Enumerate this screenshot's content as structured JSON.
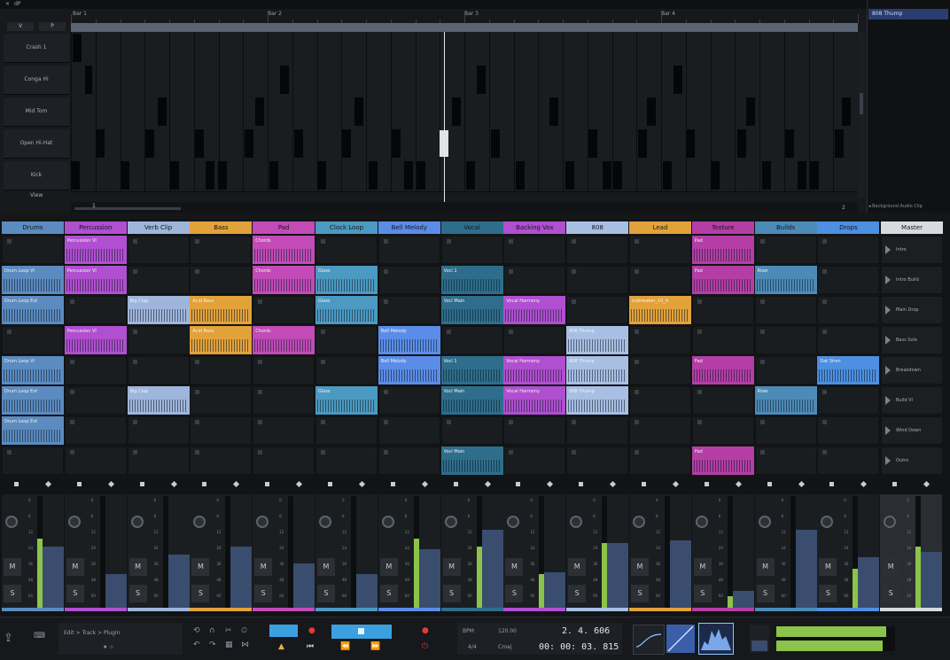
{
  "colors": {
    "drums": "#5b8bc0",
    "percussion": "#b04fd0",
    "verb_clip": "#9fb6dc",
    "bass": "#e2a23a",
    "pad": "#c24bb8",
    "clock_loop": "#4c9ac2",
    "bell_melody": "#5b8de8",
    "vocal": "#2e6e8c",
    "backing_vox": "#b04fd0",
    "p808": "#a8bfe4",
    "lead": "#e2a23a",
    "texture": "#b43ea6",
    "builds": "#4c8bb8",
    "drops": "#4d8fe0",
    "master": "#d7dbe0",
    "accent_blue": "#3aa0e0",
    "meter_green": "#8cc34a",
    "record_red": "#e23a3a"
  },
  "roll": {
    "view_buttons": [
      "V",
      "P"
    ],
    "bars": [
      "Bar 1",
      "Bar 2",
      "Bar 3",
      "Bar 4"
    ],
    "lanes": [
      "Crash 1",
      "Conga Hi",
      "Mid Tom",
      "Open Hi-Hat",
      "Kick"
    ],
    "view_label": "View",
    "position_label": "1",
    "zoom_readout": "2"
  },
  "browser": {
    "selected": "808 Thump",
    "footer": "Background Audio Clip"
  },
  "tracks": [
    {
      "name": "Drums",
      "color": "drums"
    },
    {
      "name": "Percussion",
      "color": "percussion"
    },
    {
      "name": "Verb Clip",
      "color": "verb_clip"
    },
    {
      "name": "Bass",
      "color": "bass"
    },
    {
      "name": "Pad",
      "color": "pad"
    },
    {
      "name": "Clock Loop",
      "color": "clock_loop"
    },
    {
      "name": "Bell Melody",
      "color": "bell_melody"
    },
    {
      "name": "Vocal",
      "color": "vocal"
    },
    {
      "name": "Backing Vox",
      "color": "backing_vox"
    },
    {
      "name": "808",
      "color": "p808"
    },
    {
      "name": "Lead",
      "color": "lead"
    },
    {
      "name": "Texture",
      "color": "texture"
    },
    {
      "name": "Builds",
      "color": "builds"
    },
    {
      "name": "Drops",
      "color": "drops"
    }
  ],
  "master": {
    "name": "Master"
  },
  "scenes": [
    "Intro",
    "Intro Build",
    "Main Drop",
    "Bass Solo",
    "Breakdown",
    "Build Vl",
    "Wind Down",
    "Outro"
  ],
  "clips": [
    {
      "t": 1,
      "s": 0,
      "label": "Percussion Vl"
    },
    {
      "t": 4,
      "s": 0,
      "label": "Chords"
    },
    {
      "t": 11,
      "s": 0,
      "label": "Pad"
    },
    {
      "t": 0,
      "s": 1,
      "label": "Drum Loop Vl"
    },
    {
      "t": 1,
      "s": 1,
      "label": "Percussion Vl"
    },
    {
      "t": 4,
      "s": 1,
      "label": "Chords"
    },
    {
      "t": 5,
      "s": 1,
      "label": "Glass"
    },
    {
      "t": 7,
      "s": 1,
      "label": "Vocl 1"
    },
    {
      "t": 11,
      "s": 1,
      "label": "Pad"
    },
    {
      "t": 12,
      "s": 1,
      "label": "Riser"
    },
    {
      "t": 0,
      "s": 2,
      "label": "Drum Loop Ext"
    },
    {
      "t": 2,
      "s": 2,
      "label": "Big Clap"
    },
    {
      "t": 3,
      "s": 2,
      "label": "Acid Bass"
    },
    {
      "t": 5,
      "s": 2,
      "label": "Glass"
    },
    {
      "t": 7,
      "s": 2,
      "label": "Vocl Main"
    },
    {
      "t": 8,
      "s": 2,
      "label": "Vocal Harmony"
    },
    {
      "t": 10,
      "s": 2,
      "label": "Icebreaker_10_A"
    },
    {
      "t": 1,
      "s": 3,
      "label": "Percussion Vl"
    },
    {
      "t": 3,
      "s": 3,
      "label": "Acid Bass"
    },
    {
      "t": 4,
      "s": 3,
      "label": "Chords"
    },
    {
      "t": 6,
      "s": 3,
      "label": "Bell Melody"
    },
    {
      "t": 9,
      "s": 3,
      "label": "808 Thump"
    },
    {
      "t": 0,
      "s": 4,
      "label": "Drum Loop Vl"
    },
    {
      "t": 6,
      "s": 4,
      "label": "Bell Melody"
    },
    {
      "t": 7,
      "s": 4,
      "label": "Vocl 1"
    },
    {
      "t": 8,
      "s": 4,
      "label": "Vocal Harmony"
    },
    {
      "t": 9,
      "s": 4,
      "label": "808 Thump"
    },
    {
      "t": 11,
      "s": 4,
      "label": "Pad"
    },
    {
      "t": 13,
      "s": 4,
      "label": "Dat Siren"
    },
    {
      "t": 0,
      "s": 5,
      "label": "Drum Loop Ext"
    },
    {
      "t": 2,
      "s": 5,
      "label": "Big Clap"
    },
    {
      "t": 5,
      "s": 5,
      "label": "Glass"
    },
    {
      "t": 7,
      "s": 5,
      "label": "Vocl Main"
    },
    {
      "t": 8,
      "s": 5,
      "label": "Vocal Harmony"
    },
    {
      "t": 9,
      "s": 5,
      "label": "808 Thump"
    },
    {
      "t": 12,
      "s": 5,
      "label": "Riser"
    },
    {
      "t": 0,
      "s": 6,
      "label": "Drum Loop Ext"
    },
    {
      "t": 7,
      "s": 7,
      "label": "Vocl Main"
    },
    {
      "t": 11,
      "s": 7,
      "label": "Pad"
    }
  ],
  "mixer": {
    "mute_label": "M",
    "solo_label": "S",
    "scale": [
      "0",
      "6",
      "12",
      "24",
      "36",
      "48",
      "60"
    ],
    "meters": [
      0.62,
      0.0,
      0.0,
      0.0,
      0.0,
      0.0,
      0.62,
      0.55,
      0.3,
      0.58,
      0.0,
      0.1,
      0.0,
      0.35,
      0.55
    ],
    "faders": [
      0.55,
      0.3,
      0.48,
      0.55,
      0.4,
      0.3,
      0.52,
      0.7,
      0.32,
      0.58,
      0.6,
      0.15,
      0.7,
      0.45,
      0.5
    ]
  },
  "transport": {
    "breadcrumb": "Edit > Track > Plugin",
    "rating": "★ ☆",
    "bpm_label": "BPM",
    "bpm_value": "120.00",
    "time_sig": "4/4",
    "key": "Cmaj",
    "bars_beats": "2. 4. 606",
    "time": "00: 00: 03. 815"
  }
}
